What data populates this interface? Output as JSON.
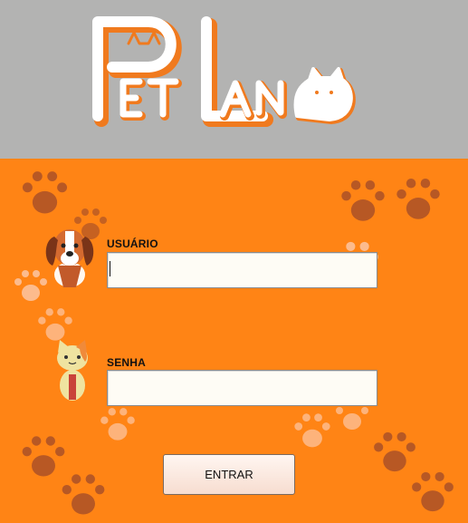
{
  "app": {
    "logo_text": "PetLand",
    "brand_colors": {
      "orange": "#ff8415",
      "header_gray": "#b3b3b2"
    }
  },
  "login": {
    "username_label": "USUÁRIO",
    "username_value": "",
    "password_label": "SENHA",
    "password_value": "",
    "submit_label": "ENTRAR"
  },
  "icons": {
    "dog": "dog-icon",
    "cat": "cat-icon",
    "paw": "paw-print-icon"
  }
}
